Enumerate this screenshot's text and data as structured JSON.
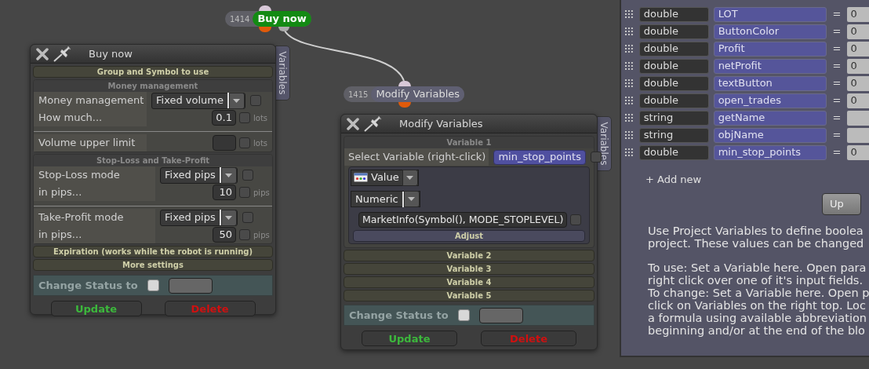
{
  "canvas_nodes": [
    {
      "number": "1414",
      "title": "Buy now",
      "kind": "action"
    },
    {
      "number": "1415",
      "title": "Modify Variables",
      "kind": "plain"
    }
  ],
  "buy_window": {
    "title": "Buy now",
    "side_tab": "Variables",
    "sections": [
      {
        "title": "Group and Symbol to use",
        "expanded": false
      },
      {
        "title": "Money management",
        "expanded": true,
        "groups": [
          [
            {
              "kind": "select",
              "label": "Money management",
              "value": "Fixed volume",
              "checked": false
            },
            {
              "kind": "number",
              "label": "How much...",
              "value": "0.1",
              "unit": "lots",
              "checked": false
            }
          ],
          [
            {
              "kind": "number",
              "label": "Volume upper limit",
              "unit": "lots",
              "checked": false
            }
          ]
        ]
      },
      {
        "title": "Stop-Loss and Take-Profit",
        "expanded": true,
        "groups": [
          [
            {
              "kind": "select",
              "label": "Stop-Loss mode",
              "value": "Fixed pips",
              "checked": false
            },
            {
              "kind": "number",
              "label": "in pips...",
              "value": "10",
              "unit": "pips",
              "checked": false
            }
          ],
          [
            {
              "kind": "select",
              "label": "Take-Profit mode",
              "value": "Fixed pips",
              "checked": false
            },
            {
              "kind": "number",
              "label": "in pips...",
              "value": "50",
              "unit": "pips",
              "checked": false
            }
          ]
        ]
      },
      {
        "title": "Expiration (works while the robot is running)",
        "expanded": false
      },
      {
        "title": "More settings",
        "expanded": false
      }
    ],
    "status": {
      "label": "Change Status to",
      "checked": false
    },
    "buttons": [
      {
        "label": "Update",
        "kind": "update"
      },
      {
        "label": "Delete",
        "kind": "delete"
      }
    ]
  },
  "modify_window": {
    "title": "Modify Variables",
    "side_tab": "Variables",
    "variables": [
      {
        "title": "Variable 1",
        "expanded": true,
        "select_label": "Select Variable (right-click)",
        "variable": "min_stop_points",
        "checked": false,
        "source": "Value",
        "type": "Numeric",
        "formula": "MarketInfo(Symbol(), MODE_STOPLEVEL)",
        "formula_checked": false,
        "adjust": "Adjust"
      },
      {
        "title": "Variable 2",
        "expanded": false
      },
      {
        "title": "Variable 3",
        "expanded": false
      },
      {
        "title": "Variable 4",
        "expanded": false
      },
      {
        "title": "Variable 5",
        "expanded": false
      }
    ],
    "status": {
      "label": "Change Status to",
      "checked": false
    },
    "buttons": [
      {
        "label": "Update",
        "kind": "update"
      },
      {
        "label": "Delete",
        "kind": "delete"
      }
    ]
  },
  "variables_panel": {
    "rows": [
      {
        "type": "double",
        "name": "LOT",
        "operator": "=",
        "value": "0"
      },
      {
        "type": "double",
        "name": "ButtonColor",
        "operator": "=",
        "value": "0"
      },
      {
        "type": "double",
        "name": "Profit",
        "operator": "=",
        "value": "0"
      },
      {
        "type": "double",
        "name": "netProfit",
        "operator": "=",
        "value": "0"
      },
      {
        "type": "double",
        "name": "textButton",
        "operator": "=",
        "value": "0"
      },
      {
        "type": "double",
        "name": "open_trades",
        "operator": "=",
        "value": "0"
      },
      {
        "type": "string",
        "name": "getName",
        "operator": "="
      },
      {
        "type": "string",
        "name": "objName",
        "operator": "="
      },
      {
        "type": "double",
        "name": "min_stop_points",
        "operator": "=",
        "value": "0"
      }
    ],
    "add_new": "+ Add new",
    "update_button": "Up",
    "paragraphs": [
      [
        "Use Project Variables to define boolea",
        "project. These values can be changed"
      ],
      [
        "To use: Set a Variable here. Open para",
        "right click over one of it's input fields.",
        "To change: Set a Variable here. Open p",
        "click on Variables on the right top. Loc",
        "a formula using available abbreviation",
        "beginning and/or at the end of the blo"
      ]
    ]
  }
}
